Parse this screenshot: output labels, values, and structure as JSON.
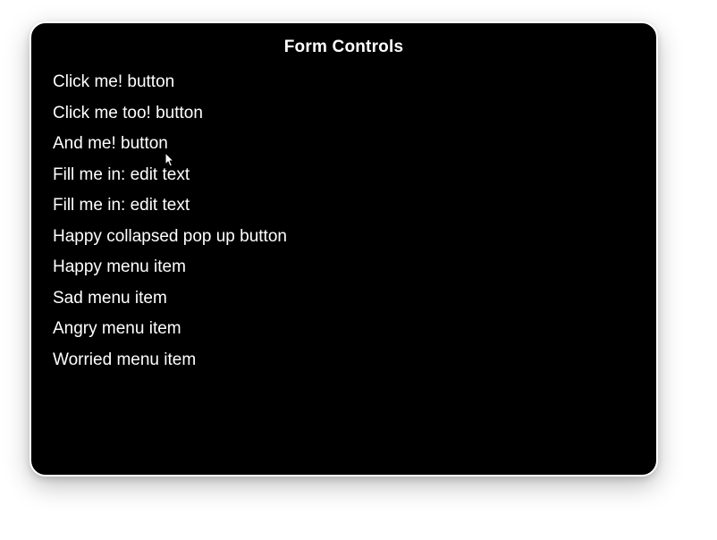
{
  "title": "Form Controls",
  "items": [
    {
      "label": "Click me! button",
      "kind": "button",
      "interactable": true,
      "name": "button-click-me"
    },
    {
      "label": "Click me too! button",
      "kind": "button",
      "interactable": true,
      "name": "button-click-me-too"
    },
    {
      "label": "And me! button",
      "kind": "button",
      "interactable": true,
      "name": "button-and-me"
    },
    {
      "label": "Fill me in: edit text",
      "kind": "edit-text",
      "interactable": true,
      "name": "edit-text-fill-me-in-1"
    },
    {
      "label": "Fill me in: edit text",
      "kind": "edit-text",
      "interactable": true,
      "name": "edit-text-fill-me-in-2"
    },
    {
      "label": "Happy collapsed pop up button",
      "kind": "popup-button",
      "interactable": true,
      "name": "popup-button-happy"
    },
    {
      "label": "Happy menu item",
      "kind": "menu-item",
      "interactable": true,
      "name": "menu-item-happy"
    },
    {
      "label": "Sad menu item",
      "kind": "menu-item",
      "interactable": true,
      "name": "menu-item-sad"
    },
    {
      "label": "Angry menu item",
      "kind": "menu-item",
      "interactable": true,
      "name": "menu-item-angry"
    },
    {
      "label": "Worried menu item",
      "kind": "menu-item",
      "interactable": true,
      "name": "menu-item-worried"
    }
  ]
}
